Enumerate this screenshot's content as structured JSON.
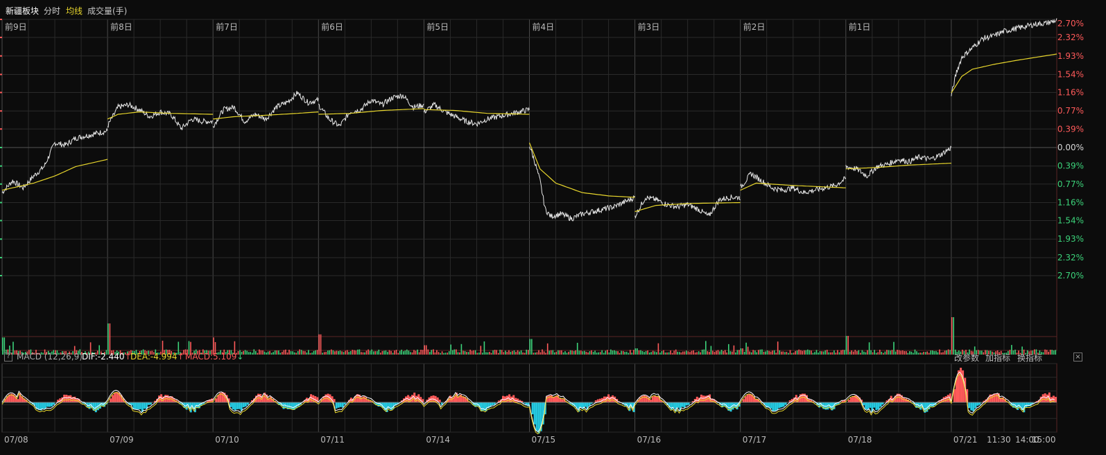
{
  "header": {
    "sector_name": "新疆板块",
    "tab_intraday": "分时",
    "tab_avgline": "均线",
    "tab_volume": "成交量(手)"
  },
  "macd_panel": {
    "label": "MACD (12,26,9)",
    "dif": "DIF:-2.440",
    "dif_arrow": "↑",
    "dea": "DEA:-4.994",
    "dea_arrow": "↑",
    "macd": "MACD:5.109",
    "macd_arrow": "↓",
    "btn_modify_params": "改参数",
    "btn_add_indicator": "加指标",
    "btn_switch_indicator": "换指标"
  },
  "colors": {
    "background": "#0c0c0c",
    "grid": "#3a1e1e",
    "price_line": "#e6e6e6",
    "avg_line": "#e8d62c",
    "up": "#ff5a5a",
    "down": "#3cd37a",
    "macd_down": "#25c9e0",
    "dif_line": "#ffffff",
    "dea_line": "#e8d62c"
  },
  "chart_data": {
    "type": "line",
    "day_labels": [
      "前9日",
      "前8日",
      "前7日",
      "前6日",
      "前5日",
      "前4日",
      "前3日",
      "前2日",
      "前1日"
    ],
    "x_date_labels": [
      "07/08",
      "07/09",
      "07/10",
      "07/11",
      "07/14",
      "07/15",
      "07/16",
      "07/17",
      "07/18",
      "07/21"
    ],
    "x_time_labels": [
      "11:30",
      "14:00",
      "15:00"
    ],
    "y_tick_labels": [
      "2.70%",
      "2.32%",
      "1.93%",
      "1.54%",
      "1.16%",
      "0.77%",
      "0.39%",
      "0.00%",
      "0.39%",
      "0.77%",
      "1.16%",
      "1.54%",
      "1.93%",
      "2.32%",
      "2.70%"
    ],
    "y_tick_values": [
      2.7,
      2.32,
      1.93,
      1.54,
      1.16,
      0.77,
      0.39,
      0.0,
      -0.39,
      -0.77,
      -1.16,
      -1.54,
      -1.93,
      -2.32,
      -2.7
    ],
    "ylim": [
      -2.7,
      2.7
    ],
    "y_unit": "%",
    "days": [
      {
        "label": "07/08",
        "price": [
          [
            0,
            -0.95
          ],
          [
            0.1,
            -0.7
          ],
          [
            0.2,
            -0.85
          ],
          [
            0.3,
            -0.6
          ],
          [
            0.4,
            -0.4
          ],
          [
            0.5,
            0.1
          ],
          [
            0.6,
            0.05
          ],
          [
            0.7,
            0.2
          ],
          [
            0.8,
            0.25
          ],
          [
            0.9,
            0.3
          ],
          [
            1.0,
            0.35
          ]
        ],
        "avg": [
          [
            0,
            -0.9
          ],
          [
            0.3,
            -0.75
          ],
          [
            0.5,
            -0.6
          ],
          [
            0.7,
            -0.4
          ],
          [
            1.0,
            -0.25
          ]
        ]
      },
      {
        "label": "07/09",
        "price": [
          [
            0,
            0.45
          ],
          [
            0.1,
            0.85
          ],
          [
            0.2,
            0.9
          ],
          [
            0.3,
            0.8
          ],
          [
            0.4,
            0.65
          ],
          [
            0.5,
            0.75
          ],
          [
            0.6,
            0.7
          ],
          [
            0.7,
            0.4
          ],
          [
            0.8,
            0.6
          ],
          [
            0.9,
            0.55
          ],
          [
            1.0,
            0.55
          ]
        ],
        "avg": [
          [
            0,
            0.6
          ],
          [
            0.1,
            0.7
          ],
          [
            0.3,
            0.75
          ],
          [
            0.6,
            0.72
          ],
          [
            1.0,
            0.7
          ]
        ]
      },
      {
        "label": "07/10",
        "price": [
          [
            0,
            0.45
          ],
          [
            0.1,
            0.8
          ],
          [
            0.2,
            0.85
          ],
          [
            0.3,
            0.55
          ],
          [
            0.4,
            0.7
          ],
          [
            0.5,
            0.6
          ],
          [
            0.6,
            0.85
          ],
          [
            0.7,
            0.95
          ],
          [
            0.8,
            1.15
          ],
          [
            0.9,
            0.95
          ],
          [
            1.0,
            1.0
          ]
        ],
        "avg": [
          [
            0,
            0.6
          ],
          [
            0.2,
            0.65
          ],
          [
            0.5,
            0.68
          ],
          [
            0.8,
            0.72
          ],
          [
            1.0,
            0.75
          ]
        ]
      },
      {
        "label": "07/11",
        "price": [
          [
            0,
            0.9
          ],
          [
            0.1,
            0.6
          ],
          [
            0.2,
            0.45
          ],
          [
            0.3,
            0.75
          ],
          [
            0.4,
            0.8
          ],
          [
            0.5,
            1.0
          ],
          [
            0.6,
            0.9
          ],
          [
            0.7,
            1.05
          ],
          [
            0.8,
            1.1
          ],
          [
            0.9,
            0.85
          ],
          [
            1.0,
            0.9
          ]
        ],
        "avg": [
          [
            0,
            0.7
          ],
          [
            0.3,
            0.72
          ],
          [
            0.6,
            0.78
          ],
          [
            1.0,
            0.82
          ]
        ]
      },
      {
        "label": "07/14",
        "price": [
          [
            0,
            0.75
          ],
          [
            0.1,
            0.9
          ],
          [
            0.2,
            0.75
          ],
          [
            0.3,
            0.65
          ],
          [
            0.4,
            0.55
          ],
          [
            0.5,
            0.5
          ],
          [
            0.6,
            0.6
          ],
          [
            0.7,
            0.65
          ],
          [
            0.8,
            0.7
          ],
          [
            0.9,
            0.75
          ],
          [
            1.0,
            0.8
          ]
        ],
        "avg": [
          [
            0,
            0.8
          ],
          [
            0.3,
            0.78
          ],
          [
            0.6,
            0.72
          ],
          [
            1.0,
            0.7
          ]
        ]
      },
      {
        "label": "07/15",
        "price": [
          [
            0,
            0.05
          ],
          [
            0.05,
            -0.3
          ],
          [
            0.1,
            -0.7
          ],
          [
            0.15,
            -1.3
          ],
          [
            0.2,
            -1.45
          ],
          [
            0.3,
            -1.4
          ],
          [
            0.4,
            -1.5
          ],
          [
            0.5,
            -1.4
          ],
          [
            0.6,
            -1.35
          ],
          [
            0.7,
            -1.3
          ],
          [
            0.8,
            -1.25
          ],
          [
            0.9,
            -1.15
          ],
          [
            1.0,
            -1.05
          ]
        ],
        "avg": [
          [
            0,
            0.1
          ],
          [
            0.1,
            -0.45
          ],
          [
            0.25,
            -0.75
          ],
          [
            0.5,
            -0.95
          ],
          [
            0.75,
            -1.02
          ],
          [
            1.0,
            -1.05
          ]
        ]
      },
      {
        "label": "07/16",
        "price": [
          [
            0,
            -1.45
          ],
          [
            0.1,
            -1.05
          ],
          [
            0.2,
            -1.1
          ],
          [
            0.3,
            -1.2
          ],
          [
            0.4,
            -1.25
          ],
          [
            0.5,
            -1.2
          ],
          [
            0.6,
            -1.3
          ],
          [
            0.7,
            -1.45
          ],
          [
            0.8,
            -1.1
          ],
          [
            0.9,
            -1.05
          ],
          [
            1.0,
            -1.05
          ]
        ],
        "avg": [
          [
            0,
            -1.35
          ],
          [
            0.2,
            -1.22
          ],
          [
            0.5,
            -1.18
          ],
          [
            1.0,
            -1.16
          ]
        ]
      },
      {
        "label": "07/17",
        "price": [
          [
            0,
            -0.85
          ],
          [
            0.1,
            -0.55
          ],
          [
            0.2,
            -0.7
          ],
          [
            0.3,
            -0.85
          ],
          [
            0.4,
            -0.9
          ],
          [
            0.5,
            -0.85
          ],
          [
            0.6,
            -0.95
          ],
          [
            0.7,
            -0.9
          ],
          [
            0.8,
            -0.85
          ],
          [
            0.9,
            -0.8
          ],
          [
            1.0,
            -0.65
          ]
        ],
        "avg": [
          [
            0,
            -0.9
          ],
          [
            0.15,
            -0.75
          ],
          [
            0.5,
            -0.8
          ],
          [
            1.0,
            -0.85
          ]
        ]
      },
      {
        "label": "07/18",
        "price": [
          [
            0,
            -0.4
          ],
          [
            0.1,
            -0.45
          ],
          [
            0.2,
            -0.6
          ],
          [
            0.3,
            -0.4
          ],
          [
            0.4,
            -0.35
          ],
          [
            0.5,
            -0.25
          ],
          [
            0.6,
            -0.3
          ],
          [
            0.7,
            -0.2
          ],
          [
            0.8,
            -0.25
          ],
          [
            0.9,
            -0.15
          ],
          [
            1.0,
            0.0
          ]
        ],
        "avg": [
          [
            0,
            -0.45
          ],
          [
            0.3,
            -0.42
          ],
          [
            0.6,
            -0.37
          ],
          [
            1.0,
            -0.33
          ]
        ]
      },
      {
        "label": "07/21",
        "price": [
          [
            0,
            1.1
          ],
          [
            0.05,
            1.6
          ],
          [
            0.1,
            1.9
          ],
          [
            0.2,
            2.1
          ],
          [
            0.3,
            2.3
          ],
          [
            0.4,
            2.35
          ],
          [
            0.5,
            2.45
          ],
          [
            0.6,
            2.5
          ],
          [
            0.7,
            2.55
          ],
          [
            0.8,
            2.6
          ],
          [
            0.9,
            2.62
          ],
          [
            1.0,
            2.68
          ]
        ],
        "avg": [
          [
            0,
            1.15
          ],
          [
            0.1,
            1.5
          ],
          [
            0.2,
            1.65
          ],
          [
            0.4,
            1.75
          ],
          [
            0.6,
            1.83
          ],
          [
            0.8,
            1.9
          ],
          [
            1.0,
            1.97
          ]
        ]
      }
    ],
    "volume_peaks": [
      0.55,
      1.0,
      0.55,
      0.65,
      0.3,
      0.5,
      0.2,
      0.2,
      0.6,
      1.2
    ],
    "macd_hist_peaks": [
      0.25,
      0.3,
      0.3,
      0.25,
      0.2,
      -0.9,
      0.2,
      0.25,
      0.2,
      1.0
    ],
    "x_label_at_close": "15:00"
  }
}
